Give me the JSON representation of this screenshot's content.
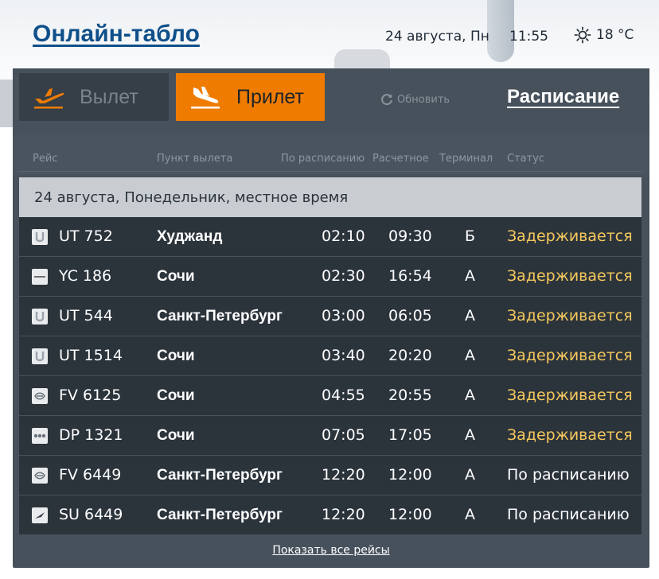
{
  "header": {
    "title": "Онлайн-табло",
    "date": "24 августа, Пн",
    "time": "11:55",
    "temperature": "18 °C",
    "weather_icon": "sun-icon"
  },
  "tabs": {
    "departure_label": "Вылет",
    "arrival_label": "Прилет",
    "active": "arrival",
    "active_color": "#ef7c00"
  },
  "refresh_label": "Обновить",
  "schedule_label": "Расписание",
  "columns": {
    "flight": "Рейс",
    "origin": "Пункт вылета",
    "scheduled": "По расписанию",
    "estimated": "Расчетное",
    "terminal": "Терминал",
    "status": "Статус"
  },
  "day_header": "24 августа, Понедельник, местное время",
  "flights": [
    {
      "logo": "utair-logo-icon",
      "flight": "UT 752",
      "city": "Худжанд",
      "scheduled": "02:10",
      "estimated": "09:30",
      "terminal": "Б",
      "status": "Задерживается",
      "delayed": true
    },
    {
      "logo": "yakutia-logo-icon",
      "flight": "YC 186",
      "city": "Сочи",
      "scheduled": "02:30",
      "estimated": "16:54",
      "terminal": "А",
      "status": "Задерживается",
      "delayed": true
    },
    {
      "logo": "utair-logo-icon",
      "flight": "UT 544",
      "city": "Санкт-Петербург",
      "scheduled": "03:00",
      "estimated": "06:05",
      "terminal": "А",
      "status": "Задерживается",
      "delayed": true
    },
    {
      "logo": "utair-logo-icon",
      "flight": "UT 1514",
      "city": "Сочи",
      "scheduled": "03:40",
      "estimated": "20:20",
      "terminal": "А",
      "status": "Задерживается",
      "delayed": true
    },
    {
      "logo": "rossiya-logo-icon",
      "flight": "FV 6125",
      "city": "Сочи",
      "scheduled": "04:55",
      "estimated": "20:55",
      "terminal": "А",
      "status": "Задерживается",
      "delayed": true
    },
    {
      "logo": "pobeda-logo-icon",
      "flight": "DP 1321",
      "city": "Сочи",
      "scheduled": "07:05",
      "estimated": "17:05",
      "terminal": "А",
      "status": "Задерживается",
      "delayed": true
    },
    {
      "logo": "rossiya-logo-icon",
      "flight": "FV 6449",
      "city": "Санкт-Петербург",
      "scheduled": "12:20",
      "estimated": "12:00",
      "terminal": "А",
      "status": "По расписанию",
      "delayed": false
    },
    {
      "logo": "aeroflot-logo-icon",
      "flight": "SU 6449",
      "city": "Санкт-Петербург",
      "scheduled": "12:20",
      "estimated": "12:00",
      "terminal": "А",
      "status": "По расписанию",
      "delayed": false
    }
  ],
  "show_all_label": "Показать все рейсы",
  "colors": {
    "delayed": "#f5c85d",
    "panel": "#47515c",
    "row": "#2b333b",
    "title": "#10508a"
  }
}
